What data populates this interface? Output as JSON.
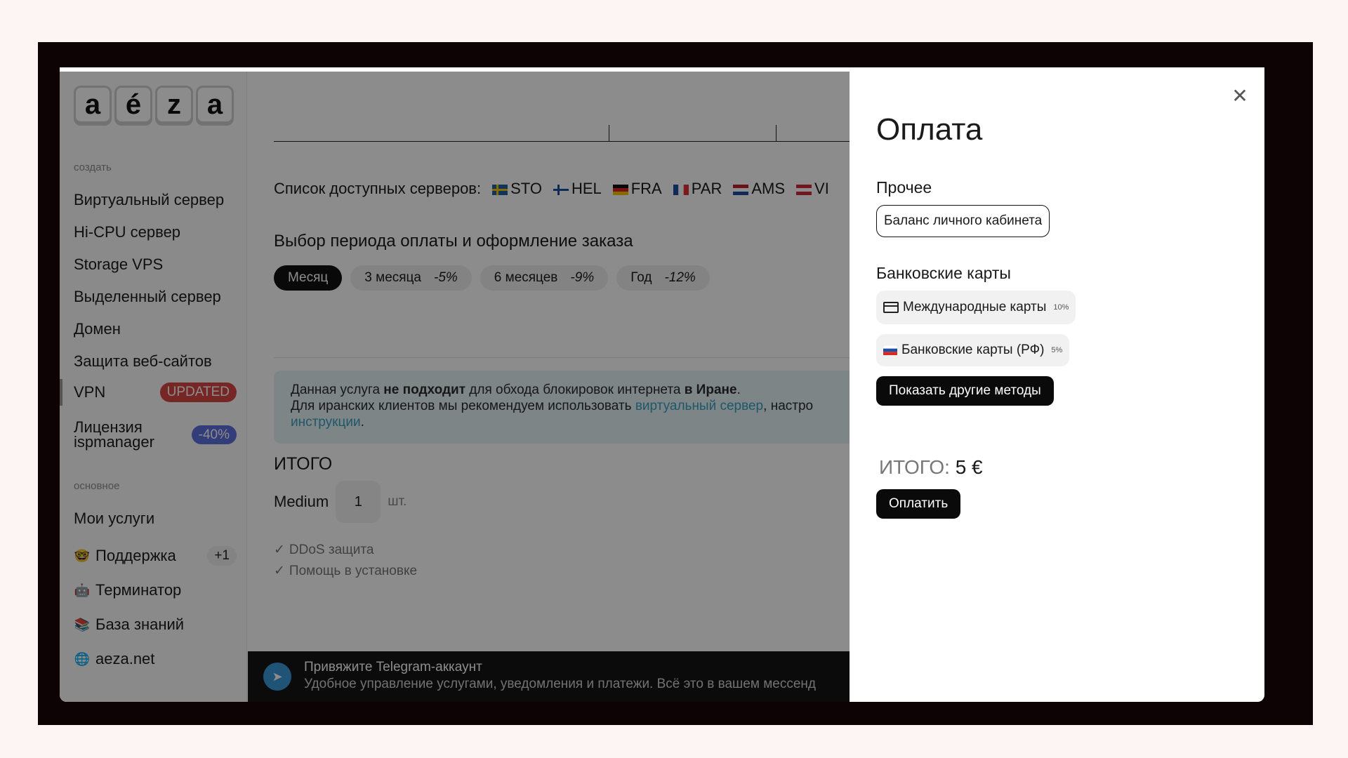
{
  "logo": {
    "letters": [
      "a",
      "é",
      "z",
      "a"
    ]
  },
  "sidebar": {
    "section_create": "создать",
    "create_items": [
      {
        "label": "Виртуальный сервер"
      },
      {
        "label": "Hi-CPU сервер"
      },
      {
        "label": "Storage VPS"
      },
      {
        "label": "Выделенный сервер"
      },
      {
        "label": "Домен"
      },
      {
        "label": "Защита веб-сайтов"
      }
    ],
    "vpn": {
      "label": "VPN",
      "badge": "UPDATED"
    },
    "license": {
      "label_line1": "Лицензия",
      "label_line2": "ispmanager",
      "badge": "-40%"
    },
    "section_main": "основное",
    "main_items": [
      {
        "label": "Мои услуги"
      },
      {
        "label": "Поддержка",
        "icon": "nerd-face-emoji",
        "badge": "+1"
      },
      {
        "label": "Терминатор",
        "icon": "robot-emoji"
      },
      {
        "label": "База знаний",
        "icon": "books-emoji"
      },
      {
        "label": "aeza.net",
        "icon": "globe-icon"
      }
    ]
  },
  "main": {
    "server_list_label": "Список доступных серверов:",
    "servers": [
      {
        "code": "STO",
        "flag": "sweden-flag"
      },
      {
        "code": "HEL",
        "flag": "finland-flag"
      },
      {
        "code": "FRA",
        "flag": "germany-flag"
      },
      {
        "code": "PAR",
        "flag": "france-flag"
      },
      {
        "code": "AMS",
        "flag": "netherlands-flag"
      },
      {
        "code": "VI",
        "flag": "austria-flag"
      }
    ],
    "period_title": "Выбор периода оплаты и оформление заказа",
    "periods": [
      {
        "label": "Месяц",
        "discount": "",
        "active": true
      },
      {
        "label": "3 месяца",
        "discount": "-5%",
        "active": false
      },
      {
        "label": "6 месяцев",
        "discount": "-9%",
        "active": false
      },
      {
        "label": "Год",
        "discount": "-12%",
        "active": false
      }
    ],
    "notice": {
      "l1_a": "Данная услуга ",
      "l1_b": "не подходит",
      "l1_c": " для обхода блокировок интернета ",
      "l1_d": "в Иране",
      "l1_e": ".",
      "l2_a": "Для иранских клиентов мы рекомендуем использовать ",
      "l2_link": "виртуальный сервер",
      "l2_b": ", настро",
      "l3_link": "инструкции",
      "l3_b": "."
    },
    "itogo_heading": "ИТОГО",
    "plan_name": "Medium",
    "quantity": "1",
    "unit": "шт.",
    "features": [
      "DDoS защита",
      "Помощь в установке"
    ],
    "telegram": {
      "title": "Привяжите Telegram-аккаунт",
      "subtitle": "Удобное управление услугами, уведомления и платежи. Всё это в вашем мессенд"
    }
  },
  "payment": {
    "title": "Оплата",
    "other_heading": "Прочее",
    "balance_method": "Баланс личного кабинета",
    "cards_heading": "Банковские карты",
    "intl_cards": {
      "label": "Международные карты",
      "fee": "10%"
    },
    "ru_cards": {
      "label": "Банковские карты (РФ)",
      "fee": "5%"
    },
    "show_more": "Показать другие методы",
    "total_label": "ИТОГО:",
    "total_value": "5 €",
    "pay_button": "Оплатить"
  },
  "colors": {
    "accent_badge_red": "#d94545",
    "accent_badge_blue": "#5d6fde",
    "link": "#3a9fc2",
    "overlay": "rgba(0,0,0,0.45)"
  }
}
